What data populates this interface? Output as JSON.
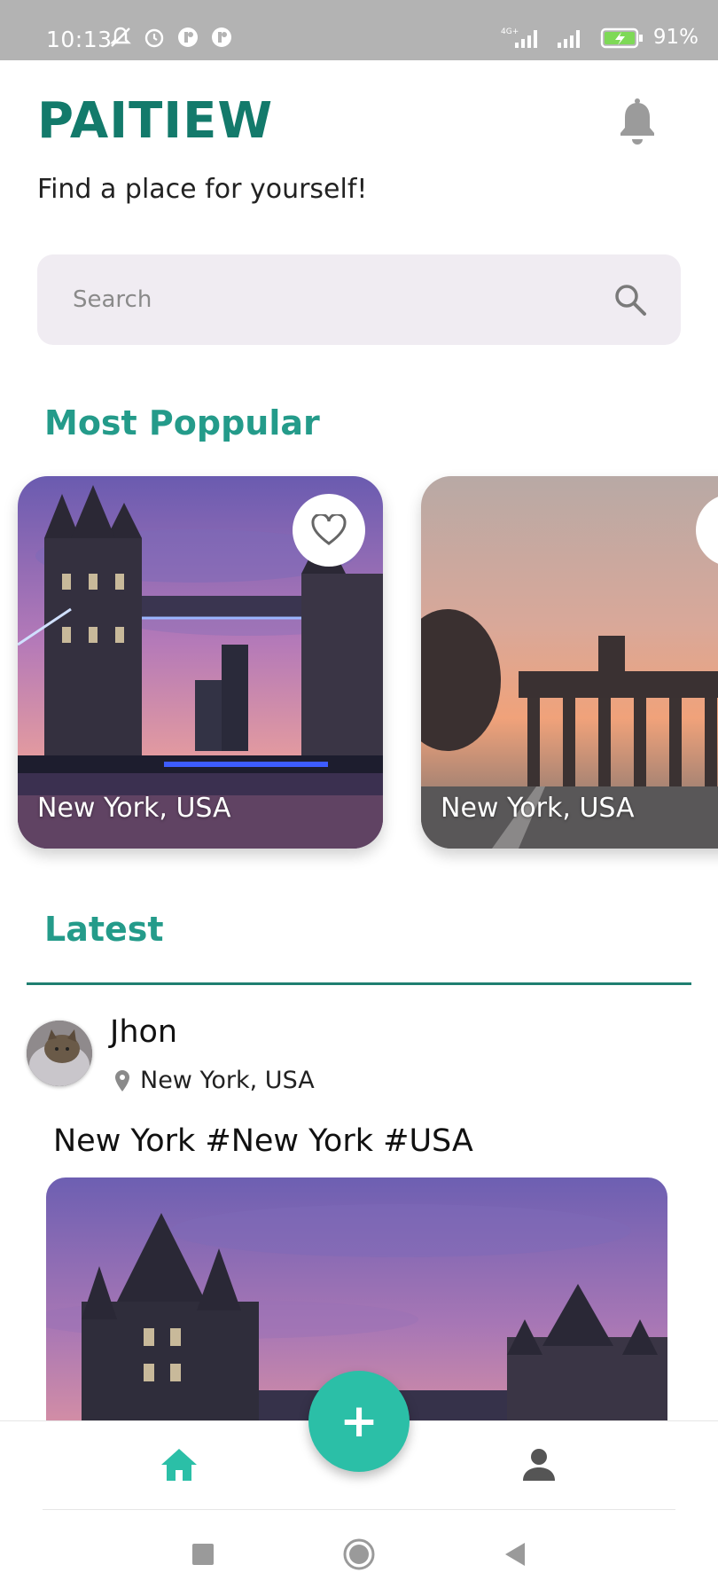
{
  "status_bar": {
    "time": "10:13",
    "battery": "91%",
    "network": "4G+"
  },
  "header": {
    "brand": "PAITIEW",
    "tagline": "Find a place for yourself!",
    "notification_icon": "bell-icon"
  },
  "search": {
    "placeholder": "Search",
    "icon": "search-icon"
  },
  "popular": {
    "title": "Most Poppular",
    "cards": [
      {
        "caption": "New York, USA",
        "scene": "tower-bridge"
      },
      {
        "caption": "New York, USA",
        "scene": "brandenburg-gate"
      }
    ]
  },
  "latest": {
    "title": "Latest",
    "post": {
      "user": "Jhon",
      "location": "New York, USA",
      "text": "New York #New York #USA"
    }
  },
  "bottom_nav": {
    "items": [
      "home-icon",
      "add-icon",
      "profile-icon"
    ],
    "accent": "#2bbfa7"
  },
  "colors": {
    "brand": "#137a6b",
    "section_title": "#249b8a",
    "accent": "#2bbfa7"
  }
}
